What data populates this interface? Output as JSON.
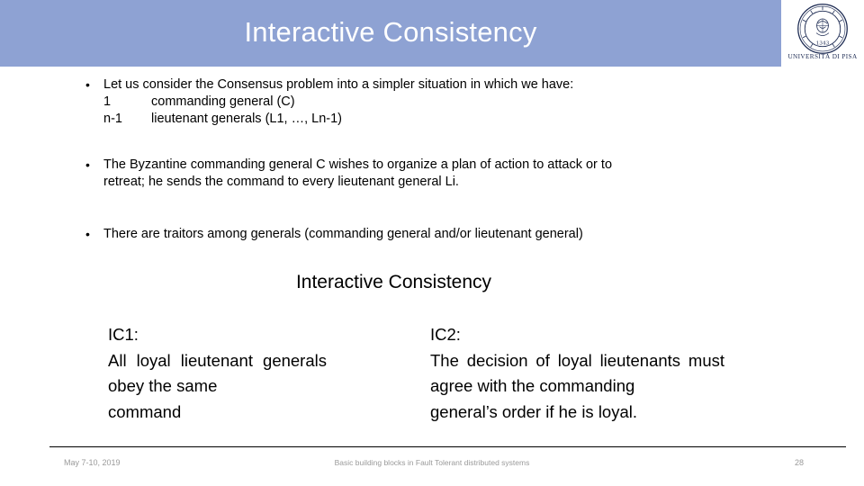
{
  "header": {
    "title": "Interactive Consistency",
    "band_color": "#8ea2d3",
    "title_color": "#ffffff"
  },
  "logo": {
    "name": "university-of-pisa-seal",
    "caption": "UNIVERSITÀ DI PISA",
    "seal_year": "1343"
  },
  "body": {
    "bullets": [
      {
        "marker": "•",
        "text": "Let us consider the Consensus problem into a simpler situation in which we have:",
        "sub_lines": [
          {
            "label": "1",
            "value": "commanding general (C)"
          },
          {
            "label": "n-1",
            "value": "lieutenant generals (L1, …, Ln-1)"
          }
        ]
      },
      {
        "marker": "•",
        "line1": "The Byzantine commanding general C wishes to organize a plan of action to attack or to",
        "line2": "retreat; he sends the command to every lieutenant general Li."
      },
      {
        "marker": "•",
        "text": "There are traitors among generals (commanding general and/or lieutenant general)"
      }
    ],
    "section_heading": "Interactive Consistency",
    "columns": [
      {
        "title": "IC1:",
        "line1": "All loyal lieutenant",
        "line2": "generals obey the same",
        "line3": "command"
      },
      {
        "title": "IC2:",
        "line1": "The decision of loyal lieutenants",
        "line2": "must agree with the commanding",
        "line3": "general’s order if he is loyal."
      }
    ]
  },
  "footer": {
    "date": "May 7-10, 2019",
    "subject": "Basic building blocks in Fault Tolerant distributed systems",
    "page_number": "28"
  }
}
